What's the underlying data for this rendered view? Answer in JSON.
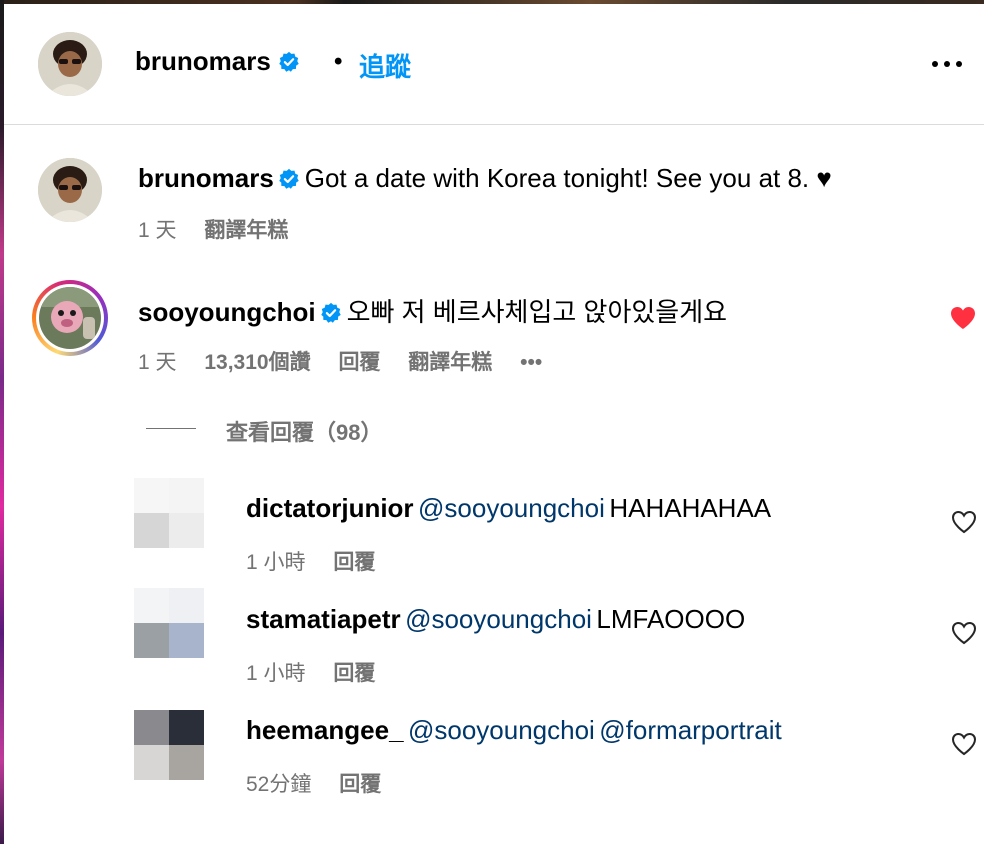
{
  "header": {
    "username": "brunomars",
    "separator": "•",
    "follow_label": "追蹤"
  },
  "caption": {
    "username": "brunomars",
    "text": "Got a date with Korea tonight! See you at 8. ♥",
    "time": "1 天",
    "translate": "翻譯年糕"
  },
  "top_comment": {
    "username": "sooyoungchoi",
    "text": "오빠 저 베르사체입고 앉아있을게요",
    "time": "1 天",
    "likes": "13,310個讚",
    "reply": "回覆",
    "translate": "翻譯年糕",
    "more": "•••",
    "liked": true
  },
  "view_replies": "查看回覆（98）",
  "replies": [
    {
      "username": "dictatorjunior",
      "mention": "@sooyoungchoi",
      "text": "HAHAHAHAA",
      "time": "1 小時",
      "reply": "回覆"
    },
    {
      "username": "stamatiapetr",
      "mention": "@sooyoungchoi",
      "text": "LMFAOOOO",
      "time": "1 小時",
      "reply": "回覆"
    },
    {
      "username": "heemangee_",
      "mention": "@sooyoungchoi",
      "text": "@formarportrait",
      "time": "52分鐘",
      "reply": "回覆"
    }
  ],
  "colors": {
    "accent_blue": "#0095f6",
    "mention_blue": "#00376b",
    "heart_red": "#ff3040",
    "meta_gray": "#737373"
  }
}
